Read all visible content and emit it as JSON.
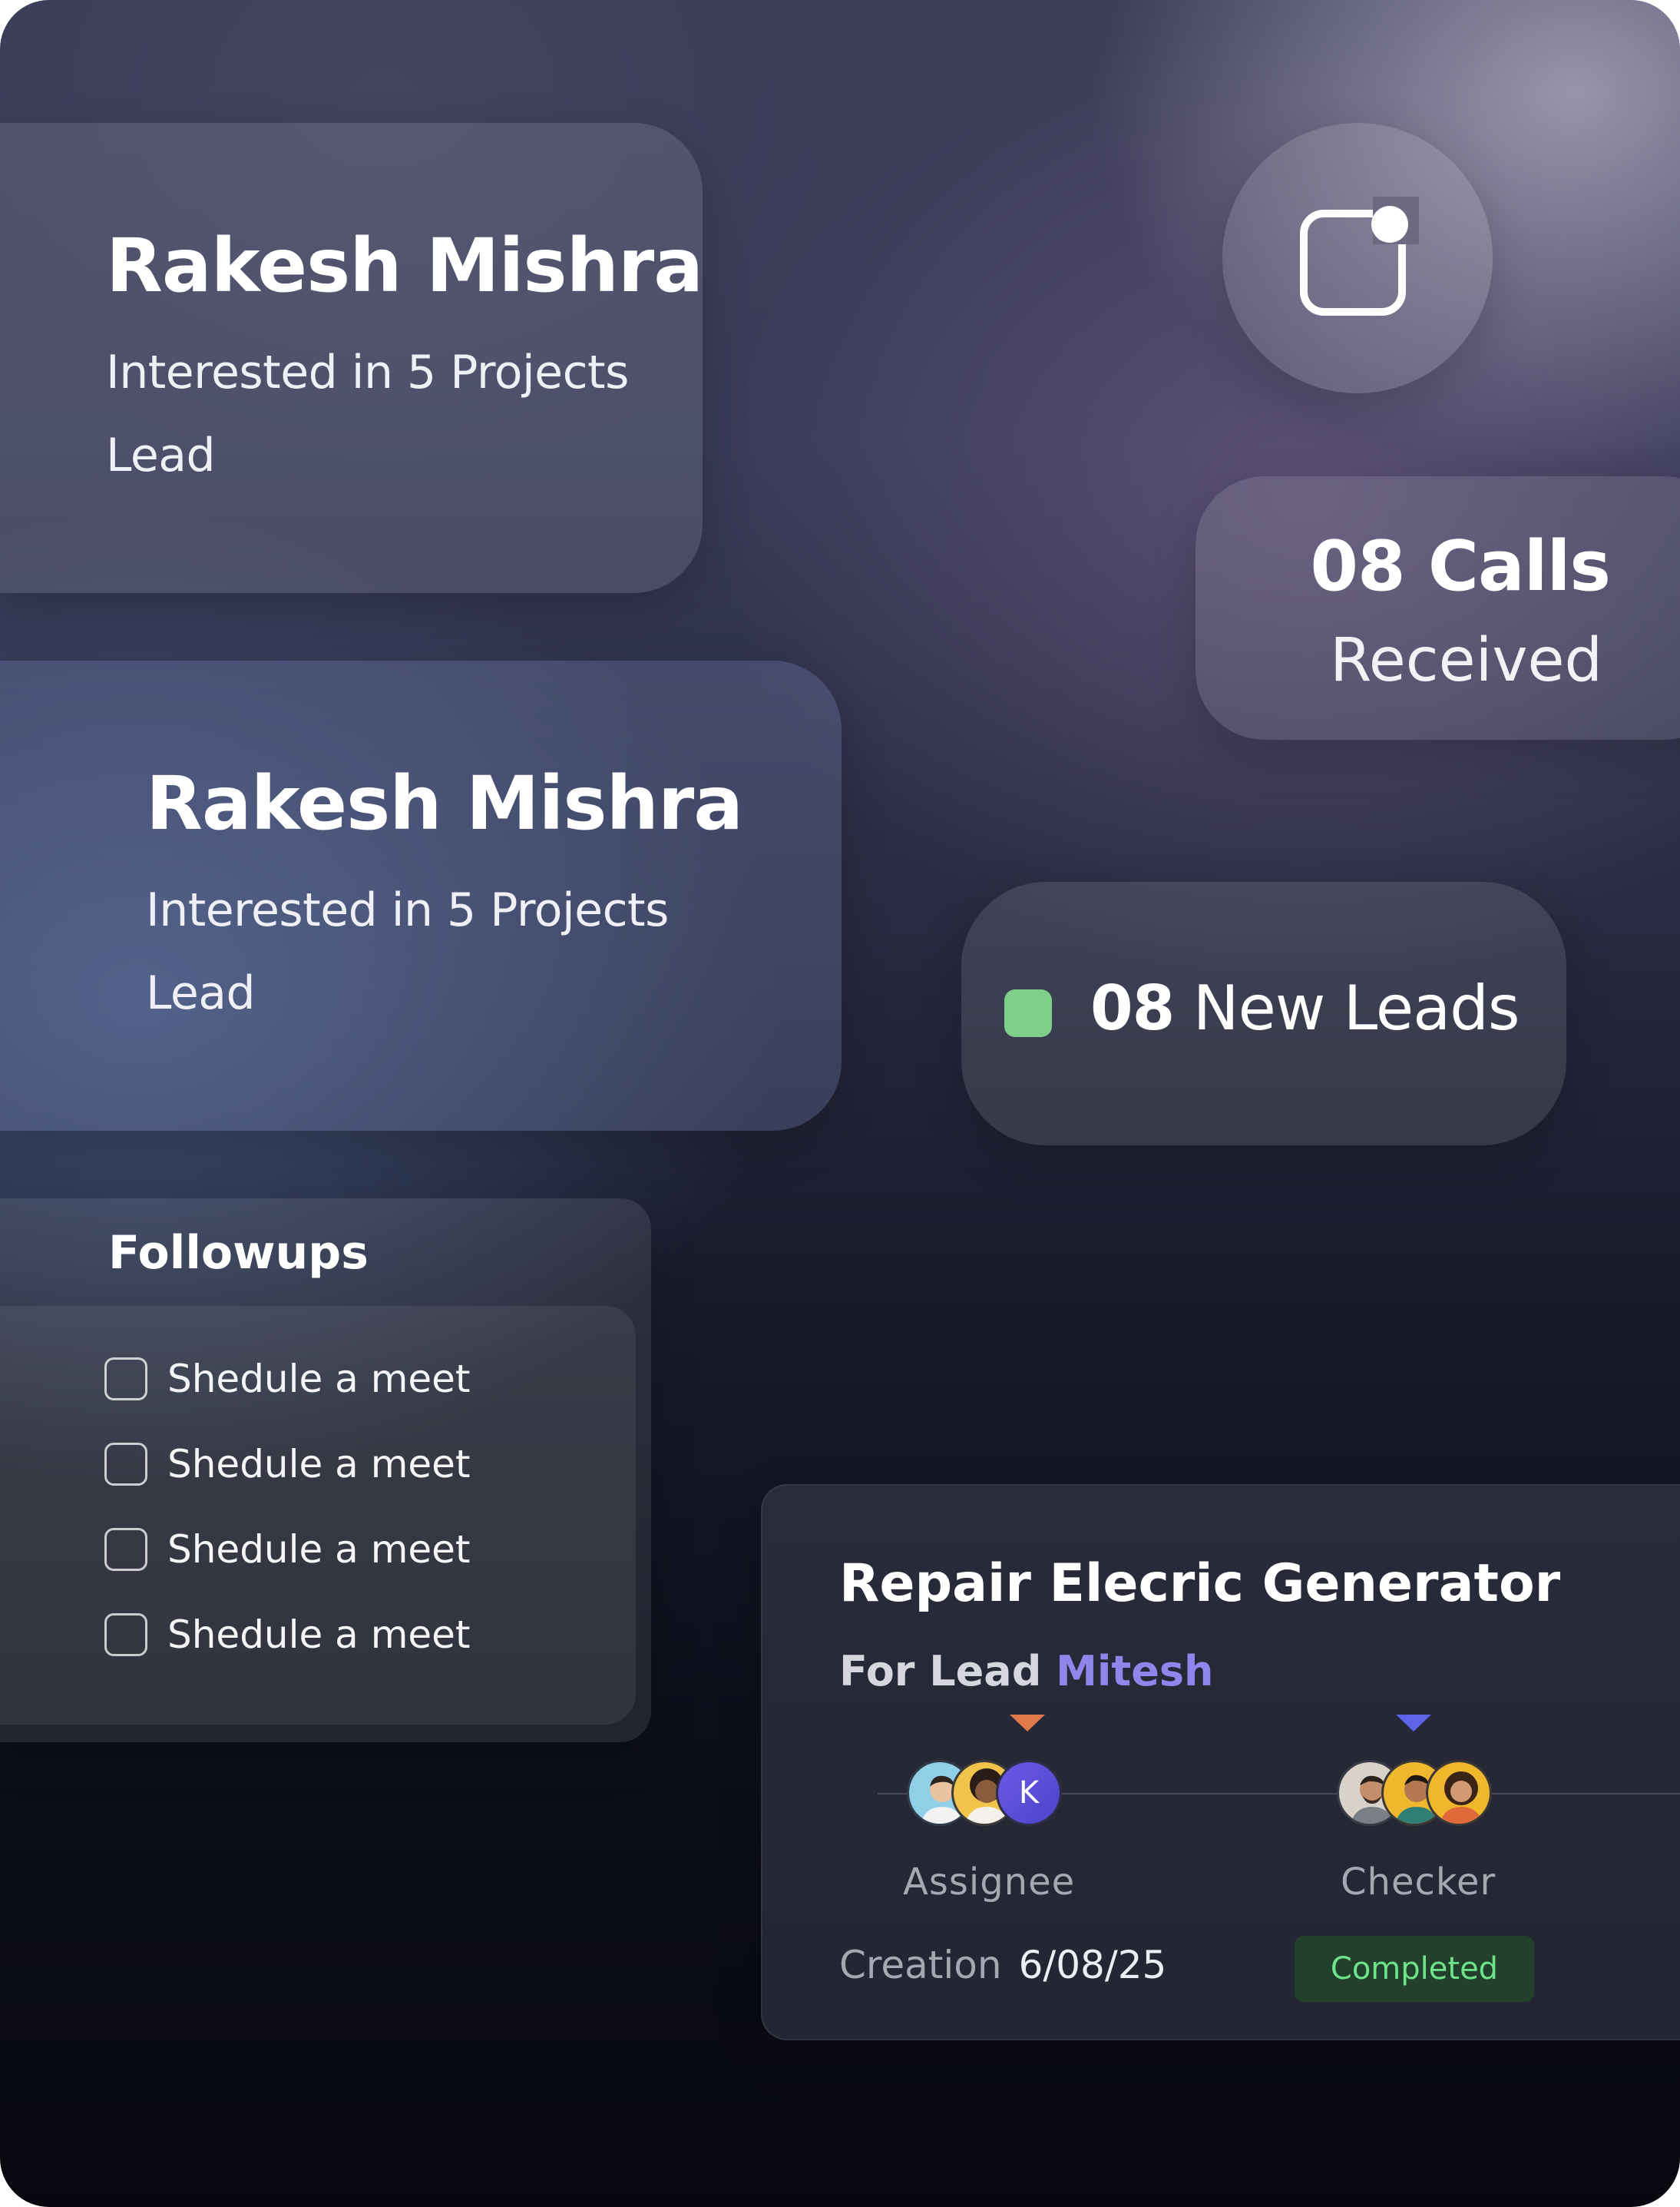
{
  "lead_cards": [
    {
      "name": "Rakesh Mishra",
      "interest": "Interested in 5 Projects",
      "stage": "Lead"
    },
    {
      "name": "Rakesh Mishra",
      "interest": "Interested in 5 Projects",
      "stage": "Lead"
    }
  ],
  "notification": {
    "icon": "notification-badge-icon"
  },
  "calls": {
    "count": "08 Calls",
    "label": "Received"
  },
  "new_leads": {
    "count": "08",
    "label": "New Leads",
    "dot_color": "#7fcf8b"
  },
  "followups": {
    "title": "Followups",
    "items": [
      {
        "label": "Shedule a meet",
        "checked": false
      },
      {
        "label": "Shedule a meet",
        "checked": false
      },
      {
        "label": "Shedule a meet",
        "checked": false
      },
      {
        "label": "Shedule a meet",
        "checked": false
      }
    ]
  },
  "task": {
    "title": "Repair Elecric Generator",
    "lead_prefix": "For Lead",
    "lead_name": "Mitesh",
    "assignee": {
      "label": "Assignee",
      "avatar_initial": "K",
      "marker_color": "#e07848"
    },
    "checker": {
      "label": "Checker",
      "marker_color": "#5e63e8"
    },
    "creation_label": "Creation",
    "creation_date": "6/08/25",
    "status": "Completed",
    "accent_color": "#8f86ec"
  }
}
